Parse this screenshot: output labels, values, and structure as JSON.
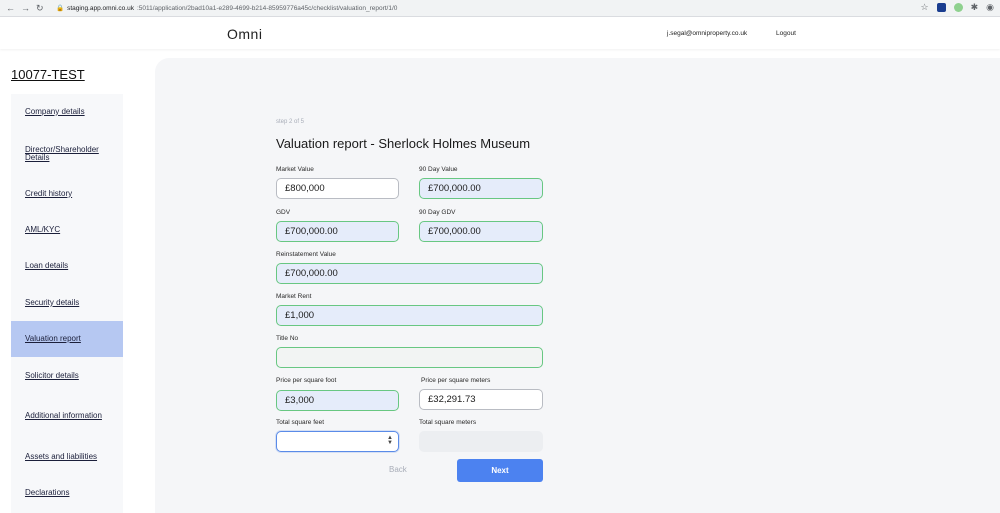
{
  "browser": {
    "url_host": "staging.app.omni.co.uk",
    "url_path": ":5011/application/2bad10a1-e289-4699-b214-85959776a45c/checklist/valuation_report/1/0"
  },
  "header": {
    "brand": "Omni",
    "user_email": "j.segal@omniproperty.co.uk",
    "logout_label": "Logout"
  },
  "case_id": "10077-TEST",
  "sidebar": {
    "items": [
      {
        "label": "Company details",
        "active": false
      },
      {
        "label": "Director/Shareholder Details",
        "active": false
      },
      {
        "label": "Credit history",
        "active": false
      },
      {
        "label": "AML/KYC",
        "active": false
      },
      {
        "label": "Loan details",
        "active": false
      },
      {
        "label": "Security details",
        "active": false
      },
      {
        "label": "Valuation report",
        "active": true
      },
      {
        "label": "Solicitor details",
        "active": false
      },
      {
        "label": "Additional information",
        "active": false
      },
      {
        "label": "Assets and liabilities",
        "active": false
      },
      {
        "label": "Declarations",
        "active": false
      }
    ]
  },
  "form": {
    "step": "step 2 of 5",
    "title": "Valuation report - Sherlock Holmes Museum",
    "market_value": {
      "label": "Market Value",
      "value": "£800,000"
    },
    "ninety_day_value": {
      "label": "90 Day Value",
      "value": "£700,000.00"
    },
    "gdv": {
      "label": "GDV",
      "value": "£700,000.00"
    },
    "ninety_day_gdv": {
      "label": "90 Day GDV",
      "value": "£700,000.00"
    },
    "reinstatement_value": {
      "label": "Reinstatement Value",
      "value": "£700,000.00"
    },
    "market_rent": {
      "label": "Market Rent",
      "value": "£1,000"
    },
    "title_no": {
      "label": "Title No",
      "value": ""
    },
    "price_per_sq_foot": {
      "label": "Price per square foot",
      "value": "£3,000"
    },
    "price_per_sq_meter": {
      "label": "Price per square meters",
      "value": "£32,291.73"
    },
    "total_sq_feet": {
      "label": "Total square feet",
      "value": ""
    },
    "total_sq_meters": {
      "label": "Total square meters",
      "value": ""
    }
  },
  "actions": {
    "back_label": "Back",
    "next_label": "Next"
  },
  "colors": {
    "accent": "#4c82f0",
    "active_sidebar": "#b6c8f2",
    "valid_border": "#68c782"
  }
}
